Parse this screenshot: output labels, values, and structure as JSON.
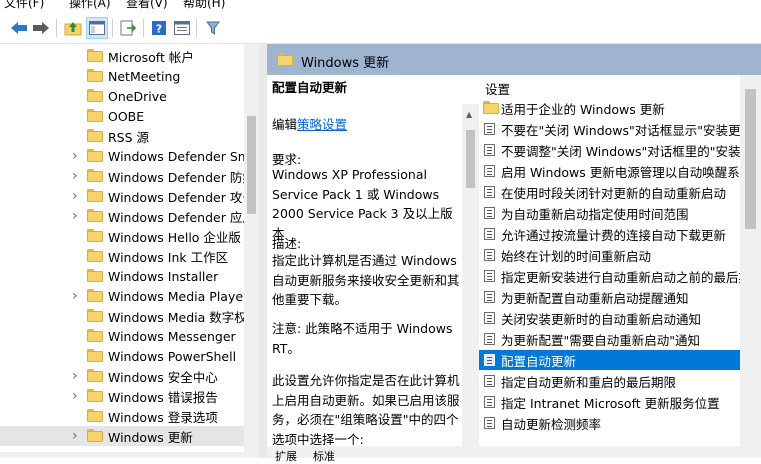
{
  "menu": [
    "文件(F)",
    "操作(A)",
    "查看(V)",
    "帮助(H)"
  ],
  "tree": {
    "items": [
      {
        "label": "Microsoft 帐户",
        "expandable": false
      },
      {
        "label": "NetMeeting",
        "expandable": false
      },
      {
        "label": "OneDrive",
        "expandable": false
      },
      {
        "label": "OOBE",
        "expandable": false
      },
      {
        "label": "RSS 源",
        "expandable": false
      },
      {
        "label": "Windows Defender SmartScreen",
        "expandable": true
      },
      {
        "label": "Windows Defender 防病毒程序",
        "expandable": true
      },
      {
        "label": "Windows Defender 攻击防护",
        "expandable": true
      },
      {
        "label": "Windows Defender 应用程序防护",
        "expandable": true
      },
      {
        "label": "Windows Hello 企业版",
        "expandable": false
      },
      {
        "label": "Windows Ink 工作区",
        "expandable": false
      },
      {
        "label": "Windows Installer",
        "expandable": false
      },
      {
        "label": "Windows Media Player",
        "expandable": true
      },
      {
        "label": "Windows Media 数字权限管理",
        "expandable": false
      },
      {
        "label": "Windows Messenger",
        "expandable": false
      },
      {
        "label": "Windows PowerShell",
        "expandable": false
      },
      {
        "label": "Windows 安全中心",
        "expandable": true
      },
      {
        "label": "Windows 错误报告",
        "expandable": true
      },
      {
        "label": "Windows 登录选项",
        "expandable": false
      },
      {
        "label": "Windows 更新",
        "expandable": true,
        "selected": true
      }
    ]
  },
  "header": {
    "title": "Windows 更新"
  },
  "description": {
    "title": "配置自动更新",
    "edit_prefix": "编辑",
    "edit_link": "策略设置",
    "req_label": "要求:",
    "req_text": "Windows XP Professional Service Pack 1 或 Windows 2000 Service Pack 3 及以上版本",
    "desc_label": "描述:",
    "desc_text": "指定此计算机是否通过 Windows 自动更新服务来接收安全更新和其他重要下载。",
    "note_text": "注意: 此策略不适用于 Windows RT。",
    "detail_text": "此设置允许你指定是否在此计算机上启用自动更新。如果已启用该服务，必须在\"组策略设置\"中的四个选项中选择一个:"
  },
  "settings": {
    "column_header": "设置",
    "items": [
      {
        "label": "适用于企业的 Windows 更新",
        "type": "folder"
      },
      {
        "label": "不要在\"关闭 Windows\"对话框显示\"安装更新并关机\"",
        "type": "policy"
      },
      {
        "label": "不要调整\"关闭 Windows\"对话框里的\"安装更新并关机\"的默认选项",
        "type": "policy"
      },
      {
        "label": "启用 Windows 更新电源管理以自动唤醒系统来安装计划的更新",
        "type": "policy"
      },
      {
        "label": "在使用时段关闭针对更新的自动重新启动",
        "type": "policy"
      },
      {
        "label": "为自动重新启动指定使用时间范围",
        "type": "policy"
      },
      {
        "label": "允许通过按流量计费的连接自动下载更新",
        "type": "policy"
      },
      {
        "label": "始终在计划的时间重新启动",
        "type": "policy"
      },
      {
        "label": "指定更新安装进行自动重新启动之前的最后期限",
        "type": "policy"
      },
      {
        "label": "为更新配置自动重新启动提醒通知",
        "type": "policy"
      },
      {
        "label": "关闭安装更新时的自动重新启动通知",
        "type": "policy"
      },
      {
        "label": "为更新配置\"需要自动重新启动\"通知",
        "type": "policy"
      },
      {
        "label": "配置自动更新",
        "type": "policy",
        "selected": true
      },
      {
        "label": "指定自动更新和重启的最后期限",
        "type": "policy"
      },
      {
        "label": "指定 Intranet Microsoft 更新服务位置",
        "type": "policy"
      },
      {
        "label": "自动更新检测频率",
        "type": "policy"
      }
    ]
  },
  "bottom_tabs": [
    "扩展",
    "标准"
  ]
}
